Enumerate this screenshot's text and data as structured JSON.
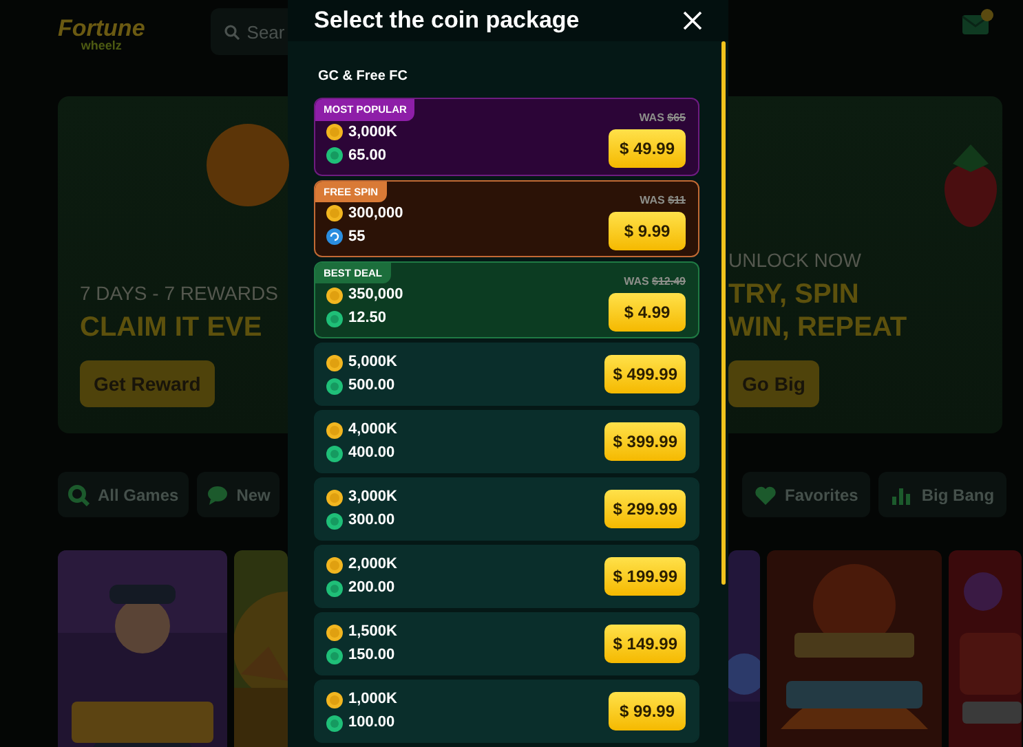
{
  "left_column": {
    "logo": {
      "title": "Fortune",
      "subtitle": "wheelz"
    },
    "search": {
      "placeholder": "Sear"
    },
    "banner": {
      "eyebrow": "7 DAYS - 7 REWARDS",
      "headline": [
        "CLAIM IT EVE"
      ],
      "button": "Get Reward"
    },
    "categories": [
      {
        "label": "All Games"
      },
      {
        "label": "New"
      }
    ]
  },
  "modal": {
    "title": "Select the coin package",
    "section": "GC & Free FC",
    "packages": [
      {
        "kind": "popular",
        "tag": "MOST POPULAR",
        "was_label": "WAS",
        "was_price": "$65",
        "coins": "3,000K",
        "bonus": "65.00",
        "price": "$ 49.99"
      },
      {
        "kind": "spin",
        "tag": "FREE SPIN",
        "was_label": "WAS",
        "was_price": "$11",
        "coins": "300,000",
        "bonus": "55",
        "price": "$ 9.99"
      },
      {
        "kind": "deal",
        "tag": "BEST DEAL",
        "was_label": "WAS",
        "was_price": "$12.49",
        "coins": "350,000",
        "bonus": "12.50",
        "price": "$ 4.99"
      },
      {
        "kind": "standard",
        "coins": "5,000K",
        "bonus": "500.00",
        "price": "$ 499.99"
      },
      {
        "kind": "standard",
        "coins": "4,000K",
        "bonus": "400.00",
        "price": "$ 399.99"
      },
      {
        "kind": "standard",
        "coins": "3,000K",
        "bonus": "300.00",
        "price": "$ 299.99"
      },
      {
        "kind": "standard",
        "coins": "2,000K",
        "bonus": "200.00",
        "price": "$ 199.99"
      },
      {
        "kind": "standard",
        "coins": "1,500K",
        "bonus": "150.00",
        "price": "$ 149.99"
      },
      {
        "kind": "standard",
        "coins": "1,000K",
        "bonus": "100.00",
        "price": "$ 99.99"
      }
    ]
  },
  "right_column": {
    "banner": {
      "eyebrow": "UNLOCK NOW",
      "headline": [
        "TRY, SPIN",
        "WIN, REPEAT"
      ],
      "button": "Go Big"
    },
    "categories": [
      {
        "label": "Favorites"
      },
      {
        "label": "Big Bang"
      }
    ]
  }
}
